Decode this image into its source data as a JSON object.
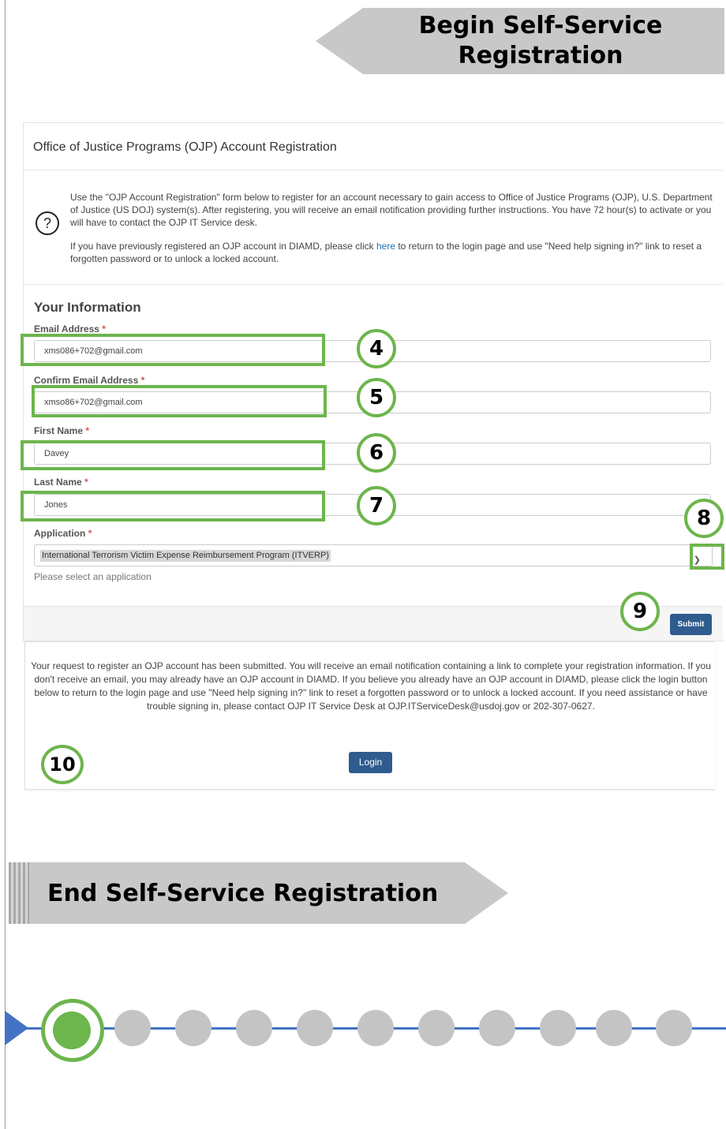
{
  "banners": {
    "begin": "Begin Self-Service Registration",
    "end": "End Self-Service Registration"
  },
  "form": {
    "title": "Office of Justice Programs (OJP) Account Registration",
    "intro_p1": "Use the \"OJP Account Registration\" form below to register for an account necessary to gain access to Office of Justice Programs (OJP), U.S. Department of Justice (US DOJ) system(s). After registering, you will receive an email notification providing further instructions. You have 72 hour(s) to activate or you will have to contact the OJP IT Service desk.",
    "intro_p2_before": "If you have previously registered an OJP account in DIAMD, please click ",
    "intro_p2_link": "here",
    "intro_p2_after": " to return to the login page and use \"Need help signing in?\" link to reset a forgotten password or to unlock a locked account.",
    "section_title": "Your Information",
    "required_marker": "*",
    "fields": {
      "email": {
        "label": "Email Address",
        "value": "xms086+702@gmail.com"
      },
      "confirm_email": {
        "label": "Confirm Email Address",
        "value": "xmso86+702@gmail.com"
      },
      "first_name": {
        "label": "First Name",
        "value": "Davey"
      },
      "last_name": {
        "label": "Last Name",
        "value": "Jones"
      },
      "application": {
        "label": "Application",
        "value": "International Terrorism Victim Expense Reimbursement Program (ITVERP)",
        "hint": "Please select an application"
      }
    },
    "submit_label": "Submit"
  },
  "confirmation": {
    "message": "Your request to register an OJP account has been submitted. You will receive an email notification containing a link to complete your registration information. If you don't receive an email, you may already have an OJP account in DIAMD. If you believe you already have an OJP account in DIAMD, please click the login button below to return to the login page and use \"Need help signing in?\" link to reset a forgotten password or to unlock a locked account. If you need assistance or have trouble signing in, please contact OJP IT Service Desk at OJP.ITServiceDesk@usdoj.gov or 202-307-0627.",
    "login_label": "Login"
  },
  "badges": [
    "4",
    "5",
    "6",
    "7",
    "8",
    "9",
    "10"
  ],
  "icons": {
    "help": "help-circle-icon",
    "dropdown": "chevron-down-icon"
  },
  "progress": {
    "total_steps": 11,
    "active_step": 1
  },
  "colors": {
    "highlight": "#6db54d",
    "primary_button": "#2f5b8e",
    "track": "#4472c4",
    "inactive_dot": "#c4c4c4"
  }
}
